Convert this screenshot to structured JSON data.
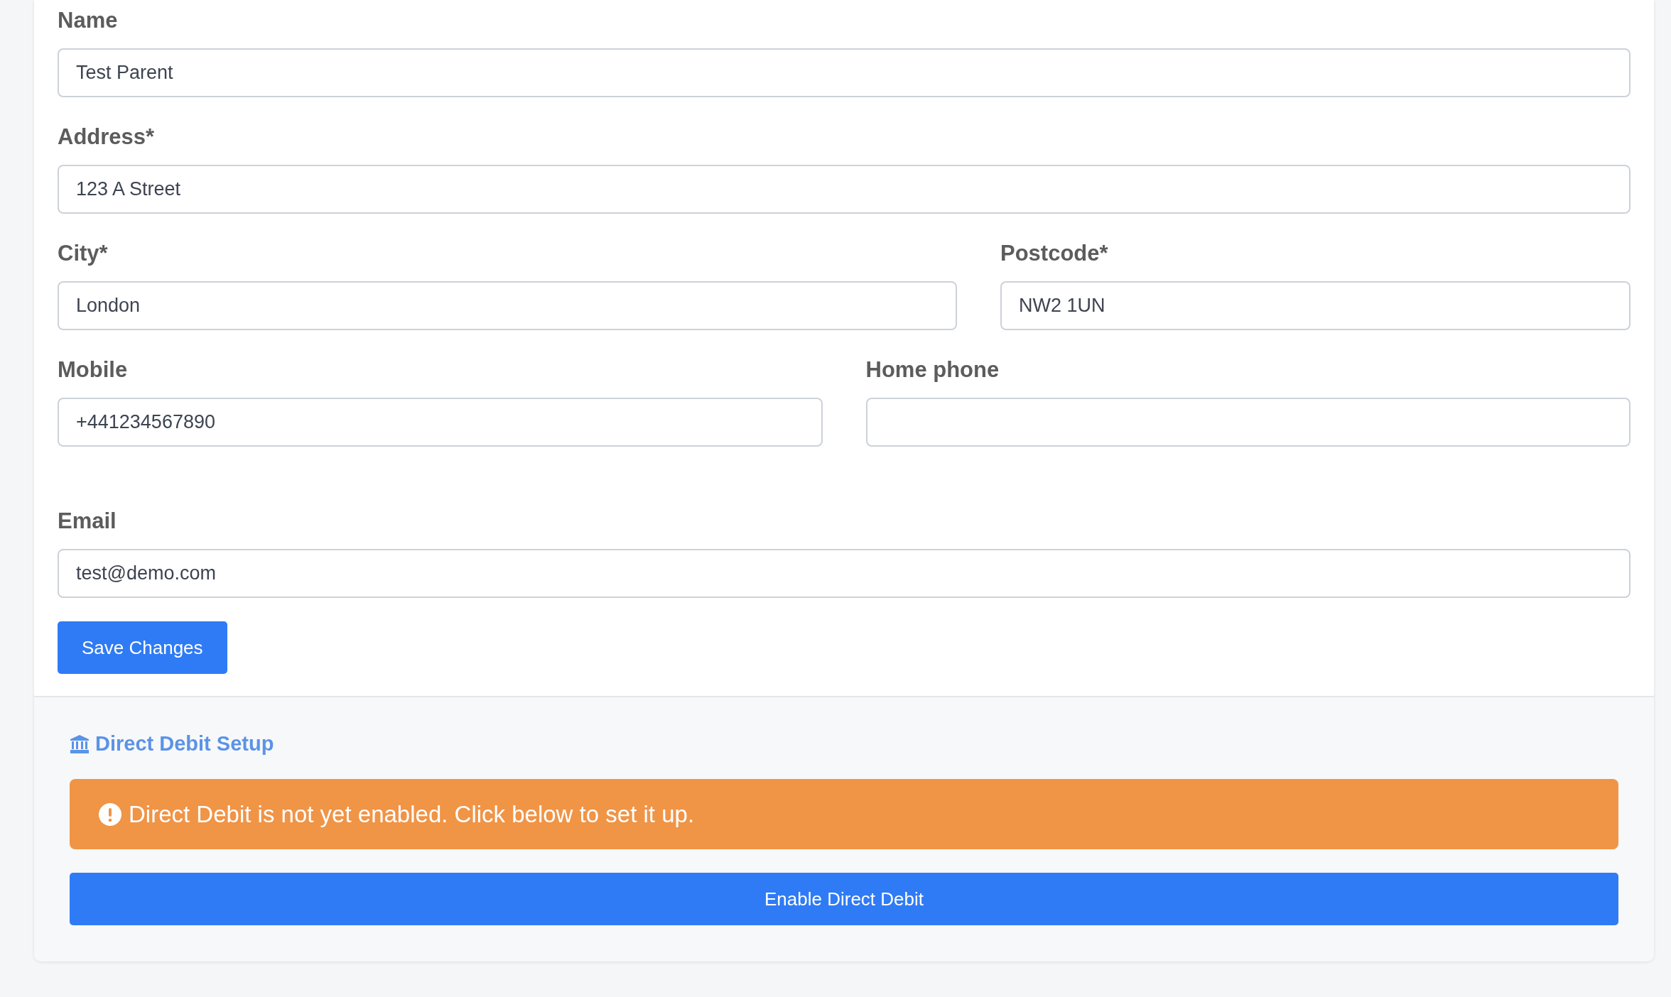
{
  "form": {
    "rows": [
      [
        {
          "label": "Name",
          "value": "Test Parent"
        }
      ],
      [
        {
          "label": "Address*",
          "value": "123 A Street"
        }
      ],
      [
        {
          "label": "City*",
          "value": "London"
        },
        {
          "label": "Postcode*",
          "value": "NW2 1UN"
        }
      ],
      [
        {
          "label": "Mobile",
          "value": "+441234567890"
        },
        {
          "label": "Home phone"
        }
      ],
      [
        {
          "label": "Email",
          "value": "test@demo.com"
        }
      ]
    ],
    "save_button": "Save Changes"
  },
  "direct_debit": {
    "title": "Direct Debit Setup",
    "alert": "Direct Debit is not yet enabled. Click below to set it up.",
    "button": "Enable Direct Debit"
  }
}
